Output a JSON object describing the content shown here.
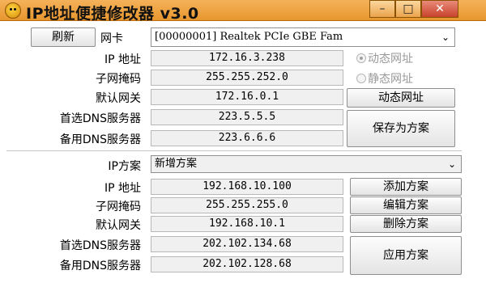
{
  "window": {
    "title": "IP地址便捷修改器 v3.0",
    "min": "–",
    "max": "□",
    "close": "✕"
  },
  "top": {
    "refresh_label": "刷新",
    "nic_label": "网卡",
    "nic_value": "[00000001] Realtek PCIe GBE Fam",
    "ip_label": "IP 地址",
    "ip_value": "172.16.3.238",
    "mask_label": "子网掩码",
    "mask_value": "255.255.252.0",
    "gateway_label": "默认网关",
    "gateway_value": "172.16.0.1",
    "dns1_label": "首选DNS服务器",
    "dns1_value": "223.5.5.5",
    "dns2_label": "备用DNS服务器",
    "dns2_value": "223.6.6.6",
    "radio_dynamic": "动态网址",
    "radio_static": "静态网址",
    "dynamic_button": "动态网址",
    "save_button": "保存为方案"
  },
  "scheme": {
    "label": "IP方案",
    "selected": "新增方案",
    "ip_label": "IP 地址",
    "ip_value": "192.168.10.100",
    "mask_label": "子网掩码",
    "mask_value": "255.255.255.0",
    "gateway_label": "默认网关",
    "gateway_value": "192.168.10.1",
    "dns1_label": "首选DNS服务器",
    "dns1_value": "202.102.134.68",
    "dns2_label": "备用DNS服务器",
    "dns2_value": "202.102.128.68",
    "add_button": "添加方案",
    "edit_button": "编辑方案",
    "delete_button": "删除方案",
    "apply_button": "应用方案"
  },
  "icons": {
    "app": "smiley-face-icon",
    "dropdown": "chevron-down-icon"
  }
}
